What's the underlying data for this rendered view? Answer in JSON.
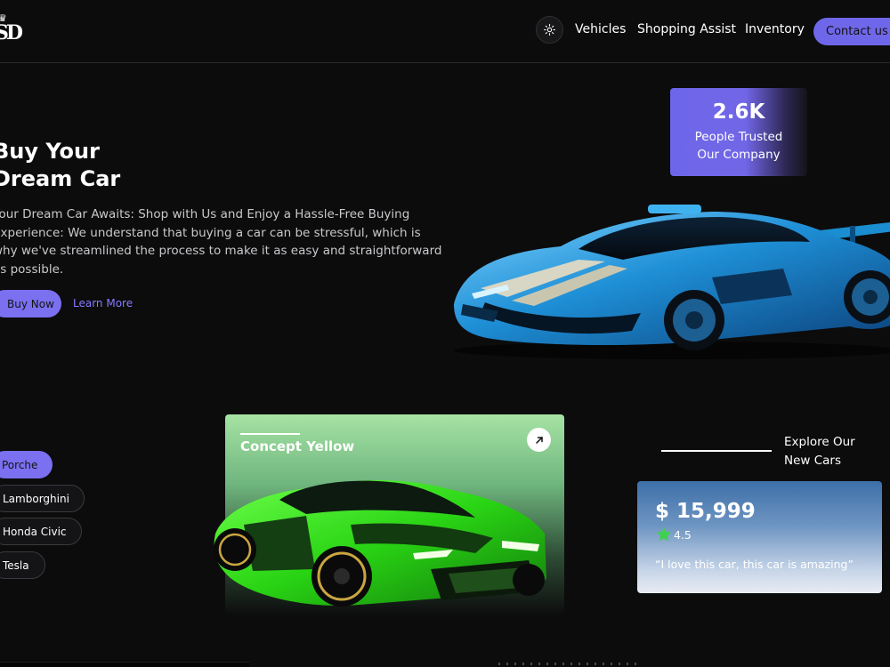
{
  "nav": {
    "links": [
      "Vehicles",
      "Shopping Assist",
      "Inventory"
    ],
    "contact_label": "Contact us"
  },
  "hero": {
    "title_line1": "Buy Your",
    "title_line2": "Dream Car",
    "description": "Your Dream Car Awaits: Shop with Us and Enjoy a Hassle-Free Buying Experience: We understand that buying a car can be stressful, which is why we've streamlined the process to make it as easy and straightforward as possible.",
    "buy_label": "Buy Now",
    "learn_label": "Learn More"
  },
  "trust": {
    "number": "2.6K",
    "label_line1": "People Trusted",
    "label_line2": "Our Company"
  },
  "brands": [
    {
      "label": "Porche",
      "active": true
    },
    {
      "label": "Lamborghini",
      "active": false
    },
    {
      "label": "Honda Civic",
      "active": false
    },
    {
      "label": "Tesla",
      "active": false
    }
  ],
  "concept": {
    "title": "Concept Yellow"
  },
  "explore": {
    "line1": "Explore Our",
    "line2": "New Cars"
  },
  "price_card": {
    "price": "$ 15,999",
    "rating": "4.5",
    "quote": "“I love this car, this car is amazing”"
  },
  "colors": {
    "accent": "#6f67ea",
    "background": "#0c0c0d",
    "star": "#3fd14e"
  },
  "icons": {
    "theme_toggle": "sun-icon",
    "concept_link": "arrow-up-right-icon",
    "rating": "star-icon",
    "logo": "crown-logo"
  }
}
